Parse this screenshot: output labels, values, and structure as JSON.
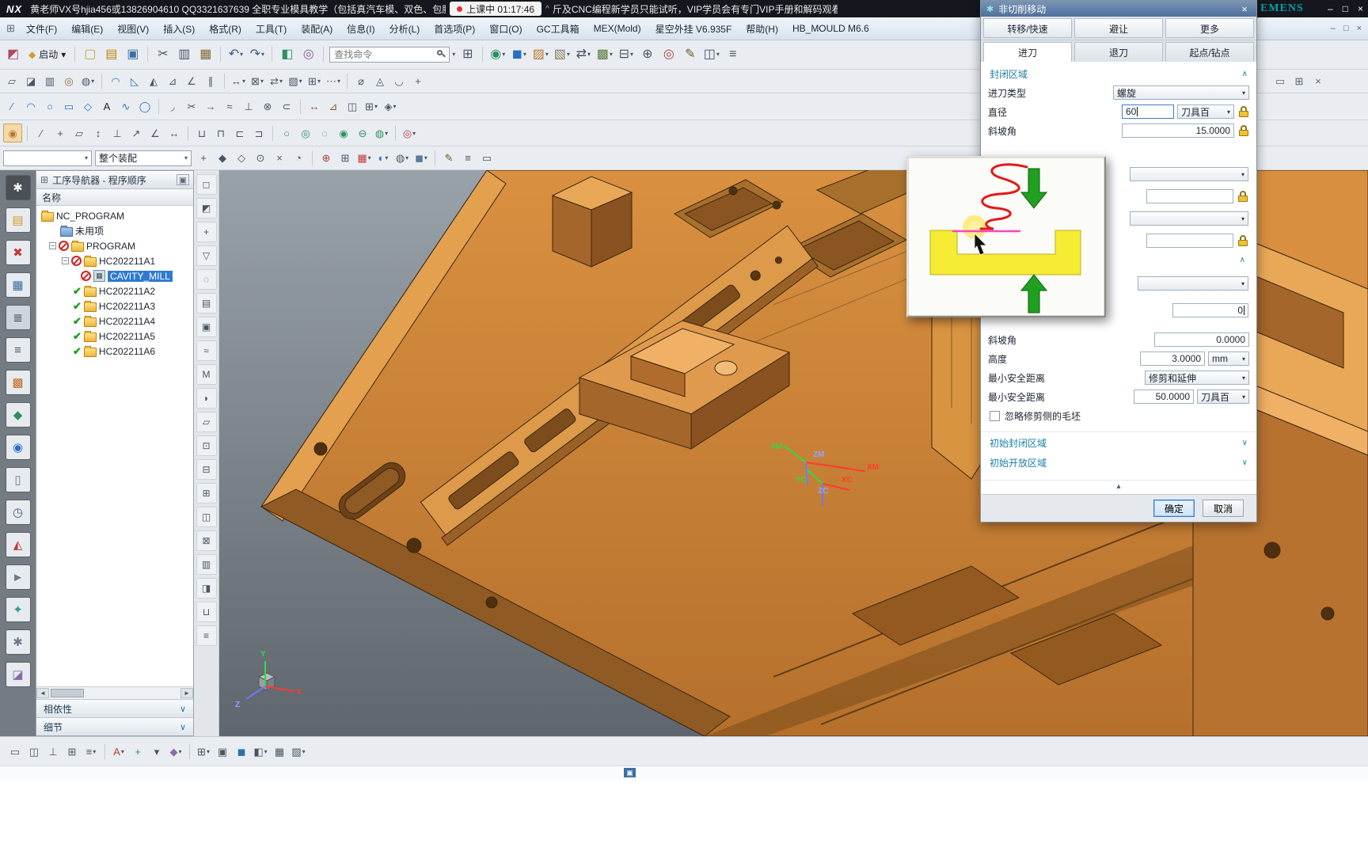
{
  "titlebar": {
    "logo": "NX",
    "title": "黄老师VX号hjia456或13826904610 QQ3321637639 全职专业模具教学（包括真汽车模、双色、包胶",
    "class_badge": "上课中 01:17:46",
    "title2": "斤及CNC编程新学员只能试听，VIP学员会有专门VIP手册和解码观看权限",
    "brand": "EMENS"
  },
  "glyphs": {
    "caret_down": "▾",
    "caret_up": "^",
    "chevron_up": "∧",
    "chevron_down": "∨",
    "minus": "−",
    "check": "✔",
    "minimize": "–",
    "maximize": "□",
    "close": "×",
    "left": "◄",
    "right": "►",
    "up_small": "▴",
    "menu_grid": "⊞",
    "gear": "✱",
    "window": "▣"
  },
  "menubar": {
    "items": [
      "文件(F)",
      "编辑(E)",
      "视图(V)",
      "插入(S)",
      "格式(R)",
      "工具(T)",
      "装配(A)",
      "信息(I)",
      "分析(L)",
      "首选项(P)",
      "窗口(O)",
      "GC工具箱",
      "MEX(Mold)",
      "星空外挂 V6.935F",
      "帮助(H)",
      "HB_MOULD M6.6"
    ]
  },
  "toolbars": {
    "start_label": "启动",
    "search_placeholder": "查找命令",
    "filter_combo": "",
    "assembly_combo": "整个装配",
    "row1pre": [
      {
        "n": "theme-palette-icon",
        "g": "◩",
        "c": "#b5485f"
      }
    ],
    "row1a": [
      {
        "t": "sep"
      },
      {
        "n": "new-file-icon",
        "g": "▢",
        "c": "#caa23a"
      },
      {
        "n": "open-file-icon",
        "g": "▤",
        "c": "#b8860b"
      },
      {
        "n": "save-icon",
        "g": "▣",
        "c": "#3a6ea5"
      },
      {
        "t": "sep"
      },
      {
        "n": "cut-icon",
        "g": "✂",
        "c": "#4a5568"
      },
      {
        "n": "copy-icon",
        "g": "▥",
        "c": "#4a5568"
      },
      {
        "n": "paste-icon",
        "g": "▦",
        "c": "#7a6a3a"
      },
      {
        "t": "sep"
      },
      {
        "n": "undo-icon",
        "g": "↶",
        "c": "#3a5a8a",
        "cr": true
      },
      {
        "n": "redo-icon",
        "g": "↷",
        "c": "#3a5a8a",
        "cr": true
      },
      {
        "t": "sep"
      },
      {
        "n": "object-display-icon",
        "g": "◧",
        "c": "#2f8f5f"
      },
      {
        "n": "show-hide-icon",
        "g": "◎",
        "c": "#8a5a9a"
      },
      {
        "t": "sep"
      }
    ],
    "row1b": [
      {
        "n": "window-layout-icon",
        "g": "⊞",
        "c": "#4a5568"
      },
      {
        "t": "sep"
      },
      {
        "n": "view-sphere-icon",
        "g": "◉",
        "c": "#2f8f5f",
        "cr": true
      },
      {
        "n": "solid-cube-icon",
        "g": "◼",
        "c": "#2a6fc0",
        "cr": true
      },
      {
        "n": "sheet-body-icon",
        "g": "▨",
        "c": "#b8762a",
        "cr": true
      },
      {
        "n": "block-icon",
        "g": "▧",
        "c": "#8a7a5a",
        "cr": true
      },
      {
        "n": "swap-view-icon",
        "g": "⇄",
        "c": "#4a5568",
        "cr": true
      },
      {
        "n": "pattern-icon",
        "g": "▩",
        "c": "#5a7a3a",
        "cr": true
      },
      {
        "n": "table-icon",
        "g": "⊟",
        "c": "#4a5568",
        "cr": true
      },
      {
        "n": "snap-icon",
        "g": "⊕",
        "c": "#4a5568"
      },
      {
        "n": "sphere-tool-icon",
        "g": "◎",
        "c": "#b04040"
      },
      {
        "n": "edit-pencil-icon",
        "g": "✎",
        "c": "#6a5a2a"
      },
      {
        "n": "toggle-panel-icon",
        "g": "◫",
        "c": "#4a5568",
        "cr": true
      },
      {
        "n": "list-icon",
        "g": "≡",
        "c": "#4a5568"
      }
    ],
    "row2": [
      {
        "n": "sketch-icon",
        "g": "▱",
        "c": "#4a5568"
      },
      {
        "n": "datum-plane-icon",
        "g": "◪",
        "c": "#4a5568"
      },
      {
        "n": "extrude-icon",
        "g": "▥",
        "c": "#4a5568"
      },
      {
        "n": "hole-icon",
        "g": "◎",
        "c": "#8a6a2a"
      },
      {
        "n": "unite-icon",
        "g": "◍",
        "c": "#4a5568",
        "cr": true
      },
      {
        "t": "sep"
      },
      {
        "n": "edge-blend-icon",
        "g": "◠",
        "c": "#2a6fc0"
      },
      {
        "n": "chamfer-icon",
        "g": "◺",
        "c": "#2a6fc0"
      },
      {
        "n": "trim-body-icon",
        "g": "◭",
        "c": "#4a5568"
      },
      {
        "n": "shell-icon",
        "g": "⊿",
        "c": "#4a5568"
      },
      {
        "n": "draft-icon",
        "g": "∠",
        "c": "#4a5568"
      },
      {
        "n": "offset-icon",
        "g": "∥",
        "c": "#4a5568"
      },
      {
        "t": "sep"
      },
      {
        "n": "move-face-icon",
        "g": "↔",
        "c": "#4a5568",
        "cr": true
      },
      {
        "n": "delete-face-icon",
        "g": "⊠",
        "c": "#4a5568",
        "cr": true
      },
      {
        "n": "replace-face-icon",
        "g": "⇄",
        "c": "#4a5568",
        "cr": true
      },
      {
        "n": "patch-icon",
        "g": "▧",
        "c": "#4a5568",
        "cr": true
      },
      {
        "n": "transform-icon",
        "g": "⊞",
        "c": "#4a5568",
        "cr": true
      },
      {
        "n": "more-tools-icon",
        "g": "⋯",
        "c": "#4a5568",
        "cr": true
      },
      {
        "t": "sep"
      },
      {
        "n": "measure-icon",
        "g": "⌀",
        "c": "#4a5568"
      },
      {
        "n": "analysis-icon",
        "g": "◬",
        "c": "#4a5568"
      },
      {
        "n": "curve-analysis-icon",
        "g": "◡",
        "c": "#4a5568"
      },
      {
        "n": "point-icon",
        "g": "+",
        "c": "#4a5568"
      }
    ],
    "row2r": [
      {
        "n": "float-window-icon",
        "g": "▭",
        "c": "#5a6470"
      },
      {
        "n": "grid-display-icon",
        "g": "⊞",
        "c": "#5a6470"
      },
      {
        "n": "close-toolbar-icon",
        "g": "×",
        "c": "#5a6470"
      }
    ],
    "row3": [
      {
        "n": "profile-line-icon",
        "g": "∕",
        "c": "#2a6fc0"
      },
      {
        "n": "arc-icon",
        "g": "◠",
        "c": "#2a6fc0"
      },
      {
        "n": "circle-icon",
        "g": "○",
        "c": "#2a6fc0"
      },
      {
        "n": "rectangle-icon",
        "g": "▭",
        "c": "#2a6fc0"
      },
      {
        "n": "polygon-icon",
        "g": "◇",
        "c": "#2a6fc0"
      },
      {
        "n": "text-icon",
        "g": "A",
        "c": "#1c2430"
      },
      {
        "n": "spline-icon",
        "g": "∿",
        "c": "#2a6fc0"
      },
      {
        "n": "ellipse-icon",
        "g": "◯",
        "c": "#2a6fc0"
      },
      {
        "t": "sep"
      },
      {
        "n": "fillet-icon",
        "g": "◞",
        "c": "#4a5568"
      },
      {
        "n": "quick-trim-icon",
        "g": "✂",
        "c": "#4a5568"
      },
      {
        "n": "extend-icon",
        "g": "→",
        "c": "#4a5568"
      },
      {
        "n": "offset-curve-icon",
        "g": "≈",
        "c": "#4a5568"
      },
      {
        "n": "project-curve-icon",
        "g": "⊥",
        "c": "#4a5568"
      },
      {
        "n": "intersect-curve-icon",
        "g": "⊗",
        "c": "#4a5568"
      },
      {
        "n": "derived-curve-icon",
        "g": "⊂",
        "c": "#4a5568"
      },
      {
        "t": "sep"
      },
      {
        "n": "dimension-icon",
        "g": "↔",
        "c": "#8a5a2a"
      },
      {
        "n": "constraint-icon",
        "g": "⊿",
        "c": "#8a5a2a"
      },
      {
        "n": "mirror-curve-icon",
        "g": "◫",
        "c": "#4a5568"
      },
      {
        "n": "array-curve-icon",
        "g": "⊞",
        "c": "#4a5568",
        "cr": true
      },
      {
        "n": "show-constraint-icon",
        "g": "◈",
        "c": "#4a5568",
        "cr": true
      }
    ],
    "row4": [
      {
        "n": "clip-icon",
        "g": "◉",
        "c": "#b8762a",
        "bg": "#f5d9a8",
        "bd": true
      },
      {
        "t": "sep"
      },
      {
        "n": "line-icon",
        "g": "∕",
        "c": "#4a5568"
      },
      {
        "n": "point2-icon",
        "g": "+",
        "c": "#4a5568"
      },
      {
        "n": "datum-plane2-icon",
        "g": "▱",
        "c": "#4a5568"
      },
      {
        "n": "datum-axis-icon",
        "g": "↕",
        "c": "#4a5568"
      },
      {
        "n": "csys-icon",
        "g": "⊥",
        "c": "#4a5568"
      },
      {
        "n": "vector-icon",
        "g": "↗",
        "c": "#4a5568"
      },
      {
        "n": "angle-icon",
        "g": "∠",
        "c": "#4a5568"
      },
      {
        "n": "distance-icon",
        "g": "↔",
        "c": "#4a5568"
      },
      {
        "t": "sep"
      },
      {
        "n": "pocket-icon",
        "g": "⊔",
        "c": "#4a5568"
      },
      {
        "n": "pad-icon",
        "g": "⊓",
        "c": "#4a5568"
      },
      {
        "n": "groove-icon",
        "g": "⊏",
        "c": "#4a5568"
      },
      {
        "n": "boss-icon",
        "g": "⊐",
        "c": "#4a5568"
      },
      {
        "t": "sep"
      },
      {
        "n": "circle-center-icon",
        "g": "○",
        "c": "#2f8f5f"
      },
      {
        "n": "circle-ring-icon",
        "g": "◎",
        "c": "#2f8f5f"
      },
      {
        "n": "circle-dashed-icon",
        "g": "◌",
        "c": "#2f8f5f"
      },
      {
        "n": "circle-filled-icon",
        "g": "◉",
        "c": "#2f8f5f"
      },
      {
        "n": "circle-minus-icon",
        "g": "⊖",
        "c": "#2f8f5f"
      },
      {
        "n": "circle-pattern-icon",
        "g": "◍",
        "c": "#2f8f5f",
        "cr": true
      },
      {
        "t": "sep"
      },
      {
        "n": "target-icon",
        "g": "◎",
        "c": "#b04040",
        "cr": true
      }
    ],
    "row5": [
      {
        "n": "snap-point-icon",
        "g": "+",
        "c": "#4a5568"
      },
      {
        "n": "endpoint-snap-icon",
        "g": "◆",
        "c": "#4a5568"
      },
      {
        "n": "midpoint-snap-icon",
        "g": "◇",
        "c": "#4a5568"
      },
      {
        "n": "center-snap-icon",
        "g": "⊙",
        "c": "#4a5568"
      },
      {
        "n": "intersection-snap-icon",
        "g": "×",
        "c": "#4a5568"
      },
      {
        "n": "quadrant-snap-icon",
        "g": "◔",
        "c": "#4a5568"
      },
      {
        "t": "sep"
      },
      {
        "n": "wcs-icon",
        "g": "⊕",
        "c": "#b04040"
      },
      {
        "n": "grid-snap-icon",
        "g": "⊞",
        "c": "#4a5568"
      },
      {
        "n": "color-grid-icon",
        "g": "▦",
        "c": "#c03a3a",
        "cr": true
      },
      {
        "n": "render-style-icon",
        "g": "◐",
        "c": "#2a6fc0",
        "cr": true
      },
      {
        "n": "wireframe-icon",
        "g": "◍",
        "c": "#4a5568",
        "cr": true
      },
      {
        "n": "shaded-icon",
        "g": "◼",
        "c": "#5a7a9a",
        "cr": true
      },
      {
        "t": "sep"
      },
      {
        "n": "annotate-icon",
        "g": "✎",
        "c": "#6a5a2a"
      },
      {
        "n": "list-view-icon",
        "g": "≡",
        "c": "#4a5568"
      },
      {
        "n": "frame-icon",
        "g": "▭",
        "c": "#4a5568"
      }
    ]
  },
  "left_strip": [
    {
      "n": "roles-icon",
      "g": "✱",
      "c": "#f0f0f0",
      "bg": "#4a5056"
    },
    {
      "n": "assembly-navigator-icon",
      "g": "▤",
      "c": "#d89a2a"
    },
    {
      "n": "constraint-navigator-icon",
      "g": "✖",
      "c": "#c03a3a"
    },
    {
      "n": "part-navigator-icon",
      "g": "▦",
      "c": "#3a6ea5"
    },
    {
      "n": "operation-navigator-icon",
      "g": "≣",
      "c": "#2a3644",
      "bg": "#cdd6de",
      "bd": true
    },
    {
      "n": "machine-tool-navigator-icon",
      "g": "≡",
      "c": "#4a5568"
    },
    {
      "n": "palette-grid-icon",
      "g": "▩",
      "c": "#c06a2a"
    },
    {
      "n": "process-studio-icon",
      "g": "◆",
      "c": "#2f8f5f"
    },
    {
      "n": "web-browser-icon",
      "g": "◉",
      "c": "#2a6fc0"
    },
    {
      "n": "history-icon",
      "g": "▯",
      "c": "#6a7a8a"
    },
    {
      "n": "clock-icon",
      "g": "◷",
      "c": "#3a5a8a"
    },
    {
      "n": "material-icon",
      "g": "◭",
      "c": "#c03a3a"
    },
    {
      "n": "pin-icon",
      "g": "►",
      "c": "#6a7a8a"
    },
    {
      "n": "touch-mode-icon",
      "g": "✦",
      "c": "#2a9a9a"
    },
    {
      "n": "customer-defaults-icon",
      "g": "✱",
      "c": "#6a7a8a"
    },
    {
      "n": "plugin-icon",
      "g": "◪",
      "c": "#8a6aaa"
    }
  ],
  "mid_strip": [
    {
      "n": "fit-view-icon",
      "g": "◻",
      "c": "#4a5560"
    },
    {
      "n": "section-view-icon",
      "g": "◩",
      "c": "#4a5560"
    },
    {
      "n": "zoom-in-icon",
      "g": "+",
      "c": "#4a5560"
    },
    {
      "n": "filter-icon",
      "g": "▽",
      "c": "#4a5560"
    },
    {
      "n": "find-icon",
      "g": "◌",
      "c": "#4a5560"
    },
    {
      "n": "layer-icon",
      "g": "▤",
      "c": "#4a5560"
    },
    {
      "n": "group-icon",
      "g": "▣",
      "c": "#4a5560"
    },
    {
      "n": "wave-link-icon",
      "g": "≈",
      "c": "#4a5560"
    },
    {
      "n": "mcs-icon",
      "g": "M",
      "c": "#4a5560"
    },
    {
      "n": "half-view-icon",
      "g": "◗",
      "c": "#4a5560"
    },
    {
      "n": "plane-view-icon",
      "g": "▱",
      "c": "#4a5560"
    },
    {
      "n": "boxed-view-icon",
      "g": "⊡",
      "c": "#4a5560"
    },
    {
      "n": "stack-icon",
      "g": "⊟",
      "c": "#4a5560"
    },
    {
      "n": "grid-view-icon",
      "g": "⊞",
      "c": "#4a5560"
    },
    {
      "n": "mirror-view-icon",
      "g": "◫",
      "c": "#4a5560"
    },
    {
      "n": "cross-icon",
      "g": "⊠",
      "c": "#4a5560"
    },
    {
      "n": "sheet-icon",
      "g": "▥",
      "c": "#4a5560"
    },
    {
      "n": "half-shade-icon",
      "g": "◨",
      "c": "#4a5560"
    },
    {
      "n": "slot-icon",
      "g": "⊔",
      "c": "#4a5560"
    },
    {
      "n": "menu-lines-icon",
      "g": "≡",
      "c": "#4a5560"
    }
  ],
  "bottom_bar": [
    {
      "n": "move-component-icon",
      "g": "▭",
      "c": "#4a5560"
    },
    {
      "n": "assemble-icon",
      "g": "◫",
      "c": "#4a5560"
    },
    {
      "n": "constraint-icon",
      "g": "⊥",
      "c": "#4a5560"
    },
    {
      "n": "pattern-component-icon",
      "g": "⊞",
      "c": "#4a5560"
    },
    {
      "n": "sequence-icon",
      "g": "≡",
      "c": "#4a5560",
      "cr": true
    },
    {
      "t": "sep"
    },
    {
      "n": "annotation-icon",
      "g": "A",
      "c": "#c03a3a",
      "cr": true
    },
    {
      "n": "add-icon",
      "g": "+",
      "c": "#2f8f5f"
    },
    {
      "n": "dropdown-icon",
      "g": "▾",
      "c": "#4a5560"
    },
    {
      "n": "scene-icon",
      "g": "◆",
      "c": "#8a6aaa",
      "cr": true
    },
    {
      "t": "sep"
    },
    {
      "n": "window-icon",
      "g": "⊞",
      "c": "#4a5560",
      "cr": true
    },
    {
      "n": "document-icon",
      "g": "▣",
      "c": "#4a5560"
    },
    {
      "n": "solid-icon",
      "g": "◼",
      "c": "#2a6fa5"
    },
    {
      "n": "shade-icon",
      "g": "◧",
      "c": "#4a5560",
      "cr": true
    },
    {
      "n": "grid-icon",
      "g": "▦",
      "c": "#4a5560"
    },
    {
      "n": "render-icon",
      "g": "▨",
      "c": "#4a5560",
      "cr": true
    }
  ],
  "navigator": {
    "title": "工序导航器 - 程序顺序",
    "col_name": "名称",
    "tree": [
      {
        "label": "NC_PROGRAM",
        "status": "none"
      },
      {
        "label": "未用项",
        "status": "none"
      },
      {
        "label": "PROGRAM",
        "status": "error"
      },
      {
        "label": "HC202211A1",
        "status": "error"
      },
      {
        "label": "CAVITY_MILL",
        "status": "error",
        "selected": true
      },
      {
        "label": "HC202211A2",
        "status": "ok"
      },
      {
        "label": "HC202211A3",
        "status": "ok"
      },
      {
        "label": "HC202211A4",
        "status": "ok"
      },
      {
        "label": "HC202211A5",
        "status": "ok"
      },
      {
        "label": "HC202211A6",
        "status": "ok"
      }
    ],
    "sections": [
      "相依性",
      "细节"
    ]
  },
  "dialog": {
    "title": "非切削移动",
    "tabs1": [
      "转移/快速",
      "避让",
      "更多"
    ],
    "tabs2": [
      "进刀",
      "退刀",
      "起点/钻点"
    ],
    "active_tab": "进刀",
    "closed_area": {
      "header": "封闭区域",
      "engage_type_label": "进刀类型",
      "engage_type_value": "螺旋",
      "diameter_label": "直径",
      "diameter_value": "60",
      "diameter_unit": "刀具百",
      "ramp_angle_label": "斜坡角",
      "ramp_angle_value": "15.0000"
    },
    "open_area": {
      "ramp_angle_label": "斜坡角",
      "ramp_angle_value": "0.0000",
      "height_label": "高度",
      "height_value": "3.0000",
      "height_unit": "mm",
      "min_clearance_label": "最小安全距离",
      "min_clearance_mode": "修剪和延伸",
      "min_clearance2_label": "最小安全距离",
      "min_clearance2_value": "50.0000",
      "min_clearance2_unit": "刀具百",
      "ignore_label": "忽略修剪侧的毛坯",
      "partial_value": "0"
    },
    "initial_closed_header": "初始封闭区域",
    "initial_open_header": "初始开放区域",
    "ok": "确定",
    "cancel": "取消"
  },
  "viewport": {
    "axes": {
      "ym": "YM",
      "zm": "ZM",
      "xm": "XM",
      "yc": "YC",
      "zc": "ZC",
      "xc": "XC",
      "x": "X",
      "y": "Y",
      "z": "Z"
    }
  }
}
